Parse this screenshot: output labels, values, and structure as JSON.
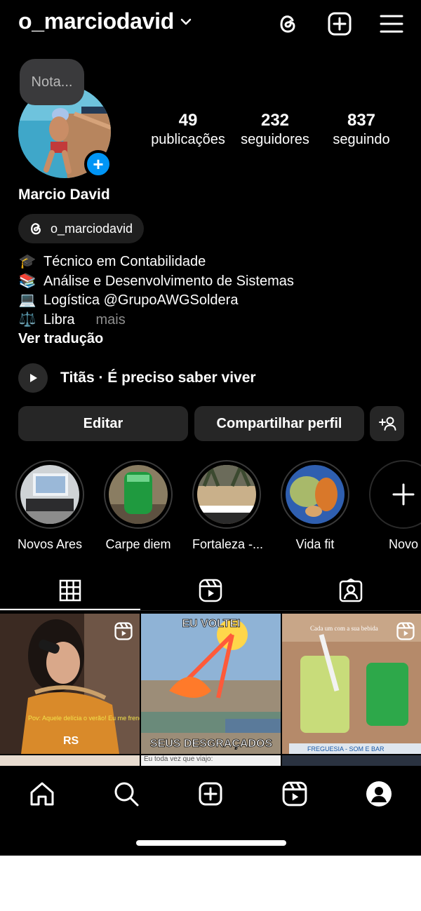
{
  "header": {
    "username": "o_marciodavid"
  },
  "profile": {
    "note_placeholder": "Nota...",
    "full_name": "Marcio David",
    "threads_handle": "o_marciodavid",
    "stats": [
      {
        "value": "49",
        "label": "publicações"
      },
      {
        "value": "232",
        "label": "seguidores"
      },
      {
        "value": "837",
        "label": "seguindo"
      }
    ],
    "bio": [
      {
        "emoji": "🎓",
        "text": "Técnico em Contabilidade"
      },
      {
        "emoji": "📚",
        "text": "Análise e Desenvolvimento de Sistemas"
      },
      {
        "emoji": "💻",
        "text": "Logística @GrupoAWGSoldera"
      },
      {
        "emoji": "⚖️",
        "text": "Libra"
      }
    ],
    "more_label": "mais",
    "translate_label": "Ver tradução",
    "music": "Titãs · É preciso saber viver"
  },
  "actions": {
    "edit": "Editar",
    "share": "Compartilhar perfil"
  },
  "highlights": [
    {
      "label": "Novos Ares"
    },
    {
      "label": "Carpe diem"
    },
    {
      "label": "Fortaleza -..."
    },
    {
      "label": "Vida fit"
    },
    {
      "label": "Novo"
    }
  ],
  "grid": {
    "post1_caption": "Pov: Aquele delícia o verão! Eu me frendo de calor.",
    "post1_watermark": "RS",
    "post2_top": "EU VOLTEI",
    "post2_bottom": "SEUS DESGRAÇADOS",
    "post3_top": "Cada um com a sua bebida",
    "post3_location": "FREGUESIA - SOM E BAR",
    "post5_partial": "Eu toda vez que viajo:"
  },
  "colors": {
    "accent": "#0095f6",
    "background": "#000000",
    "button": "#262626"
  }
}
